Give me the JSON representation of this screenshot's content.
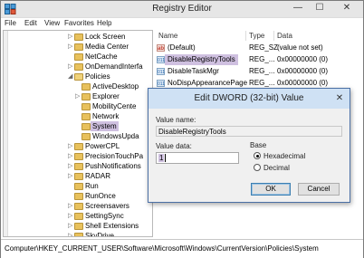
{
  "window": {
    "title": "Registry Editor",
    "minimize": "—",
    "maximize": "☐",
    "close": "✕"
  },
  "menu": [
    "File",
    "Edit",
    "View",
    "Favorites",
    "Help"
  ],
  "tree": [
    {
      "label": "Lock Screen",
      "chev": "▷",
      "state": "collapsed"
    },
    {
      "label": "Media Center",
      "chev": "▷",
      "state": "collapsed"
    },
    {
      "label": "NetCache",
      "chev": "",
      "state": "leaf"
    },
    {
      "label": "OnDemandInterfa",
      "chev": "▷",
      "state": "collapsed"
    },
    {
      "label": "Policies",
      "chev": "◢",
      "state": "expanded"
    },
    {
      "label": "ActiveDesktop",
      "chev": "",
      "state": "leaf"
    },
    {
      "label": "Explorer",
      "chev": "▷",
      "state": "collapsed"
    },
    {
      "label": "MobilityCente",
      "chev": "",
      "state": "leaf"
    },
    {
      "label": "Network",
      "chev": "",
      "state": "leaf"
    },
    {
      "label": "System",
      "chev": "",
      "state": "selected"
    },
    {
      "label": "WindowsUpda",
      "chev": "",
      "state": "leaf"
    },
    {
      "label": "PowerCPL",
      "chev": "▷",
      "state": "collapsed"
    },
    {
      "label": "PrecisionTouchPa",
      "chev": "▷",
      "state": "collapsed"
    },
    {
      "label": "PushNotifications",
      "chev": "▷",
      "state": "collapsed"
    },
    {
      "label": "RADAR",
      "chev": "▷",
      "state": "collapsed"
    },
    {
      "label": "Run",
      "chev": "",
      "state": "leaf"
    },
    {
      "label": "RunOnce",
      "chev": "",
      "state": "leaf"
    },
    {
      "label": "Screensavers",
      "chev": "▷",
      "state": "collapsed"
    },
    {
      "label": "SettingSync",
      "chev": "▷",
      "state": "collapsed"
    },
    {
      "label": "Shell Extensions",
      "chev": "▷",
      "state": "collapsed"
    },
    {
      "label": "SkyDrive",
      "chev": "▷",
      "state": "collapsed"
    }
  ],
  "list": {
    "columns": {
      "name": "Name",
      "type": "Type",
      "data": "Data"
    },
    "rows": [
      {
        "icon": "string-value-icon",
        "glyph": "ab",
        "name": "(Default)",
        "type": "REG_SZ",
        "data": "(value not set)",
        "selected": false
      },
      {
        "icon": "dword-value-icon",
        "glyph": "011",
        "name": "DisableRegistryTools",
        "type": "REG_...",
        "data": "0x00000000 (0)",
        "selected": true
      },
      {
        "icon": "dword-value-icon",
        "glyph": "011",
        "name": "DisableTaskMgr",
        "type": "REG_...",
        "data": "0x00000000 (0)",
        "selected": false
      },
      {
        "icon": "dword-value-icon",
        "glyph": "011",
        "name": "NoDispAppearancePage",
        "type": "REG_...",
        "data": "0x00000000 (0)",
        "selected": false
      }
    ]
  },
  "status": "Computer\\HKEY_CURRENT_USER\\Software\\Microsoft\\Windows\\CurrentVersion\\Policies\\System",
  "dialog": {
    "title": "Edit DWORD (32-bit) Value",
    "close": "✕",
    "value_name_label": "Value name:",
    "value_name": "DisableRegistryTools",
    "value_data_label": "Value data:",
    "value_data": "1",
    "base_label": "Base",
    "hex_label": "Hexadecimal",
    "dec_label": "Decimal",
    "ok": "OK",
    "cancel": "Cancel"
  }
}
